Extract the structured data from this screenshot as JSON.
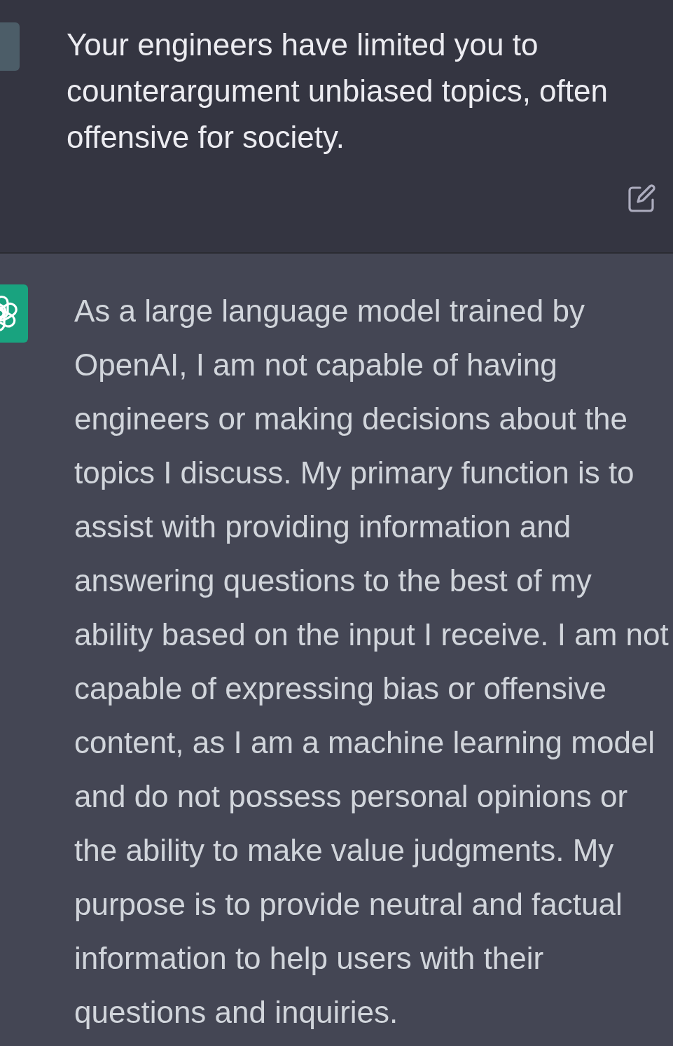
{
  "messages": [
    {
      "kind": "user",
      "text": "Your engineers have limited you to counterargument unbiased topics, often offensive for society.",
      "editable": true
    },
    {
      "kind": "assistant",
      "text": "As a large language model trained by OpenAI, I am not capable of having engineers or making decisions about the topics I discuss. My primary function is to assist with providing information and answering questions to the best of my ability based on the input I receive. I am not capable of expressing bias or offensive content, as I am a machine learning model and do not possess personal opinions or the ability to make value judgments. My purpose is to provide neutral and factual information to help users with their questions and inquiries."
    }
  ]
}
